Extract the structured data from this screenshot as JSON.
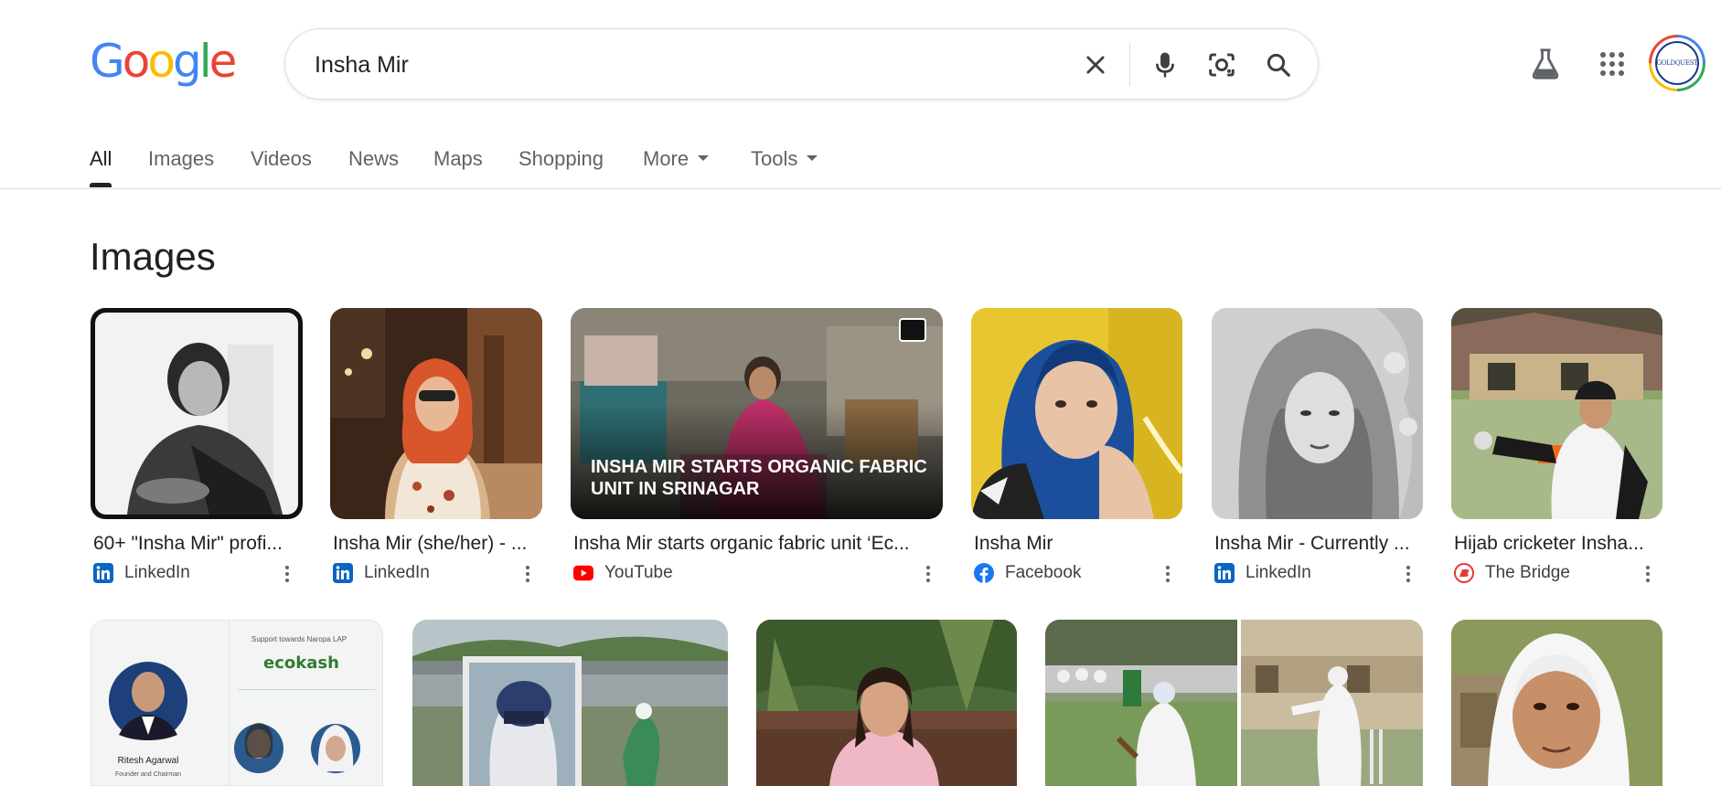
{
  "search": {
    "query": "Insha Mir"
  },
  "tabs": [
    "All",
    "Images",
    "Videos",
    "News",
    "Maps",
    "Shopping",
    "More",
    "Tools"
  ],
  "section_title": "Images",
  "colors": {
    "google_blue": "#4285f4",
    "google_red": "#ea4335",
    "google_yellow": "#fbbc05",
    "google_green": "#34a853",
    "linkedin": "#0a66c2",
    "youtube": "#ff0000",
    "facebook": "#1877f2",
    "the_bridge": "#e53935"
  },
  "avatar_text": "GOLDQUEST",
  "images": [
    {
      "title": "60+ \"Insha Mir\" profi...",
      "source": "LinkedIn",
      "source_icon": "linkedin-icon"
    },
    {
      "title": "Insha Mir (she/her) - ...",
      "source": "LinkedIn",
      "source_icon": "linkedin-icon"
    },
    {
      "title": "Insha Mir starts organic fabric unit ‘Ec...",
      "source": "YouTube",
      "source_icon": "youtube-icon",
      "caption": "INSHA MIR STARTS ORGANIC FABRIC UNIT IN SRINAGAR"
    },
    {
      "title": "Insha Mir",
      "source": "Facebook",
      "source_icon": "facebook-icon"
    },
    {
      "title": "Insha Mir - Currently ...",
      "source": "LinkedIn",
      "source_icon": "linkedin-icon"
    },
    {
      "title": "Hijab cricketer Insha...",
      "source": "The Bridge",
      "source_icon": "the-bridge-icon"
    }
  ],
  "row2": {
    "ecokash_support": "Support towards Naropa LAP",
    "ecokash_logo": "ecokash",
    "ecokash_person": "Ritesh Agarwal",
    "ecokash_role": "Founder and Chairman"
  }
}
